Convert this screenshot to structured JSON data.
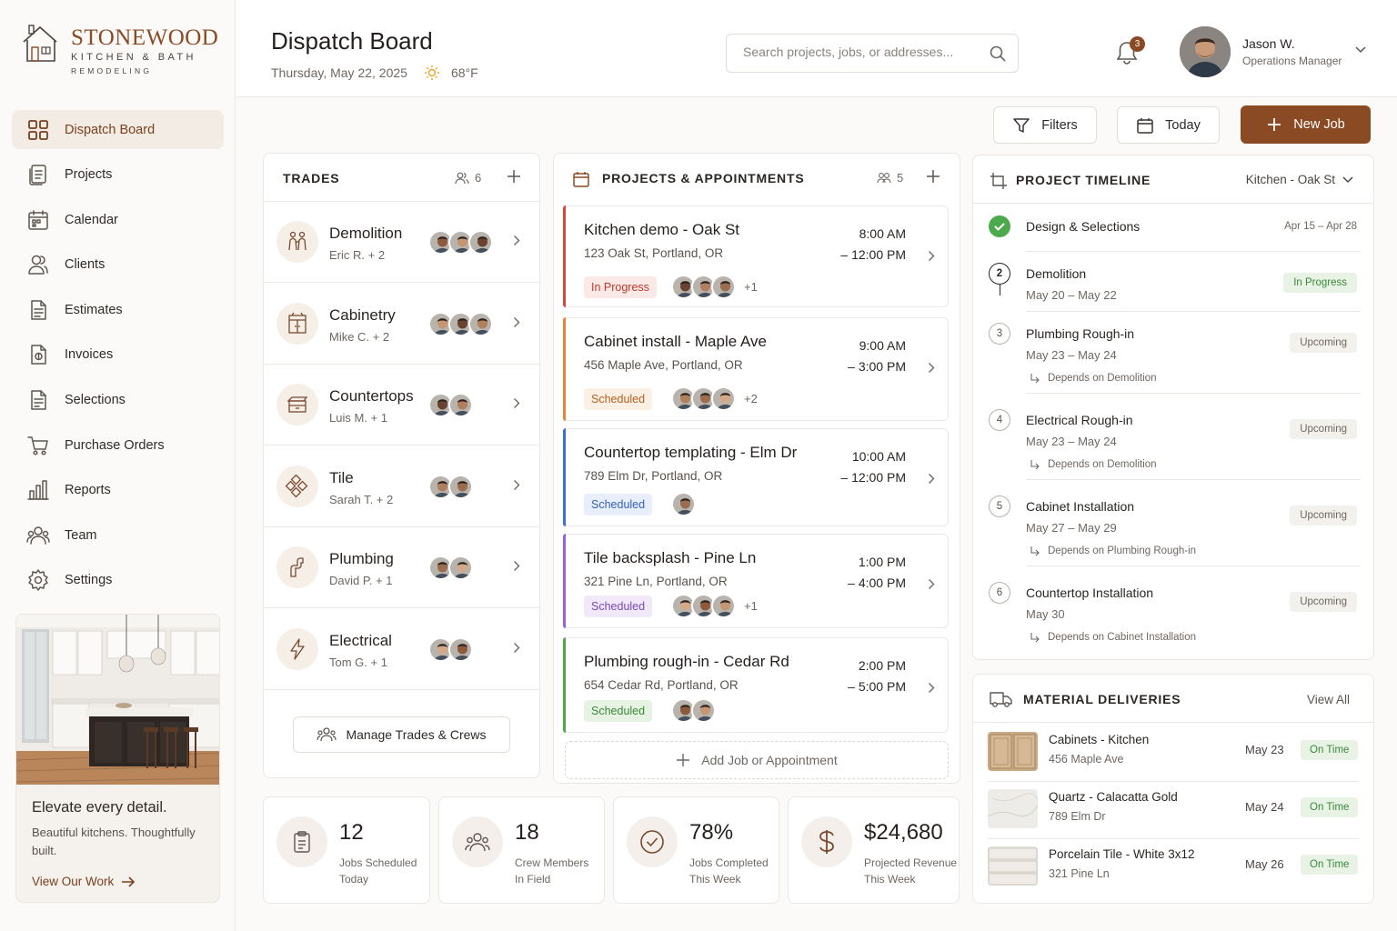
{
  "brand": {
    "name": "STONEWOOD",
    "line1": "KITCHEN & BATH",
    "line2": "REMODELING"
  },
  "nav": [
    {
      "label": "Dispatch Board",
      "icon": "grid-icon",
      "active": true
    },
    {
      "label": "Projects",
      "icon": "folder-icon"
    },
    {
      "label": "Calendar",
      "icon": "calendar-icon"
    },
    {
      "label": "Clients",
      "icon": "users-icon"
    },
    {
      "label": "Estimates",
      "icon": "document-icon"
    },
    {
      "label": "Invoices",
      "icon": "invoice-icon"
    },
    {
      "label": "Selections",
      "icon": "checklist-icon"
    },
    {
      "label": "Purchase Orders",
      "icon": "cart-icon"
    },
    {
      "label": "Reports",
      "icon": "chart-icon"
    },
    {
      "label": "Team",
      "icon": "team-icon"
    },
    {
      "label": "Settings",
      "icon": "gear-icon"
    }
  ],
  "promo": {
    "title": "Elevate every detail.",
    "text": "Beautiful kitchens. Thoughtfully built.",
    "cta": "View Our Work"
  },
  "header": {
    "title": "Dispatch Board",
    "date": "Thursday, May 22, 2025",
    "weather": "68°F",
    "search_placeholder": "Search projects, jobs, or addresses...",
    "notifications": "3",
    "user_name": "Jason W.",
    "user_role": "Operations Manager"
  },
  "toolbar": {
    "filters": "Filters",
    "today": "Today",
    "new_job": "New Job"
  },
  "trades": {
    "title": "TRADES",
    "count": "6",
    "items": [
      {
        "name": "Demolition",
        "lead": "Eric R. + 2",
        "icon": "demolition-icon",
        "crew": 3
      },
      {
        "name": "Cabinetry",
        "lead": "Mike C. + 2",
        "icon": "cabinet-icon",
        "crew": 3
      },
      {
        "name": "Countertops",
        "lead": "Luis M. + 1",
        "icon": "countertop-icon",
        "crew": 2
      },
      {
        "name": "Tile",
        "lead": "Sarah T. + 2",
        "icon": "tile-icon",
        "crew": 2
      },
      {
        "name": "Plumbing",
        "lead": "David P. + 1",
        "icon": "plumbing-icon",
        "crew": 2
      },
      {
        "name": "Electrical",
        "lead": "Tom G. + 1",
        "icon": "lightning-icon",
        "crew": 2
      }
    ],
    "manage": "Manage Trades & Crews"
  },
  "projects": {
    "title": "PROJECTS & APPOINTMENTS",
    "count": "5",
    "items": [
      {
        "title": "Kitchen demo - Oak St",
        "address": "123 Oak St, Portland, OR",
        "start": "8:00 AM",
        "end": "– 12:00 PM",
        "status": "In Progress",
        "color": "#d8453a",
        "status_bg": "#fbe9e7",
        "status_fg": "#c0392b",
        "crew": 3,
        "more": "+1"
      },
      {
        "title": "Cabinet install - Maple Ave",
        "address": "456 Maple Ave, Portland, OR",
        "start": "9:00 AM",
        "end": "– 3:00 PM",
        "status": "Scheduled",
        "color": "#e8843a",
        "status_bg": "#fcefe4",
        "status_fg": "#b5601f",
        "crew": 3,
        "more": "+2"
      },
      {
        "title": "Countertop templating - Elm Dr",
        "address": "789 Elm Dr, Portland, OR",
        "start": "10:00 AM",
        "end": "– 12:00 PM",
        "status": "Scheduled",
        "color": "#3b6fd6",
        "status_bg": "#e8eefb",
        "status_fg": "#3561b8",
        "crew": 1,
        "more": ""
      },
      {
        "title": "Tile backsplash - Pine Ln",
        "address": "321 Pine Ln, Portland, OR",
        "start": "1:00 PM",
        "end": "– 4:00 PM",
        "status": "Scheduled",
        "color": "#9a63d4",
        "status_bg": "#f1e9fa",
        "status_fg": "#7a49b0",
        "crew": 3,
        "more": "+1"
      },
      {
        "title": "Plumbing rough-in - Cedar Rd",
        "address": "654 Cedar Rd, Portland, OR",
        "start": "2:00 PM",
        "end": "– 5:00 PM",
        "status": "Scheduled",
        "color": "#4caa4c",
        "status_bg": "#e6f3e3",
        "status_fg": "#3b8a3b",
        "crew": 2,
        "more": ""
      }
    ],
    "add": "Add Job or Appointment"
  },
  "timeline": {
    "title": "PROJECT TIMELINE",
    "selected": "Kitchen - Oak St",
    "steps": [
      {
        "n": "",
        "name": "Design & Selections",
        "dates": "Apr 15 – Apr 28",
        "status": "",
        "dep": ""
      },
      {
        "n": "2",
        "name": "Demolition",
        "dates": "May 20 – May 22",
        "status": "In Progress",
        "dep": ""
      },
      {
        "n": "3",
        "name": "Plumbing Rough-in",
        "dates": "May 23 – May 24",
        "status": "Upcoming",
        "dep": "Depends on Demolition"
      },
      {
        "n": "4",
        "name": "Electrical Rough-in",
        "dates": "May 23 – May 24",
        "status": "Upcoming",
        "dep": "Depends on Demolition"
      },
      {
        "n": "5",
        "name": "Cabinet Installation",
        "dates": "May 27 – May 29",
        "status": "Upcoming",
        "dep": "Depends on Plumbing Rough-in"
      },
      {
        "n": "6",
        "name": "Countertop Installation",
        "dates": "May 30",
        "status": "Upcoming",
        "dep": "Depends on Cabinet Installation"
      }
    ]
  },
  "deliveries": {
    "title": "MATERIAL DELIVERIES",
    "view_all": "View All",
    "items": [
      {
        "name": "Cabinets - Kitchen",
        "address": "456 Maple Ave",
        "date": "May 23",
        "status": "On Time"
      },
      {
        "name": "Quartz - Calacatta Gold",
        "address": "789 Elm Dr",
        "date": "May 24",
        "status": "On Time"
      },
      {
        "name": "Porcelain Tile - White 3x12",
        "address": "321 Pine Ln",
        "date": "May 26",
        "status": "On Time"
      }
    ]
  },
  "stats": [
    {
      "value": "12",
      "label1": "Jobs Scheduled",
      "label2": "Today",
      "icon": "clipboard-icon"
    },
    {
      "value": "18",
      "label1": "Crew Members",
      "label2": "In Field",
      "icon": "team-icon"
    },
    {
      "value": "78%",
      "label1": "Jobs Completed",
      "label2": "This Week",
      "icon": "check-circle-icon"
    },
    {
      "value": "$24,680",
      "label1": "Projected Revenue",
      "label2": "This Week",
      "icon": "dollar-icon"
    }
  ]
}
